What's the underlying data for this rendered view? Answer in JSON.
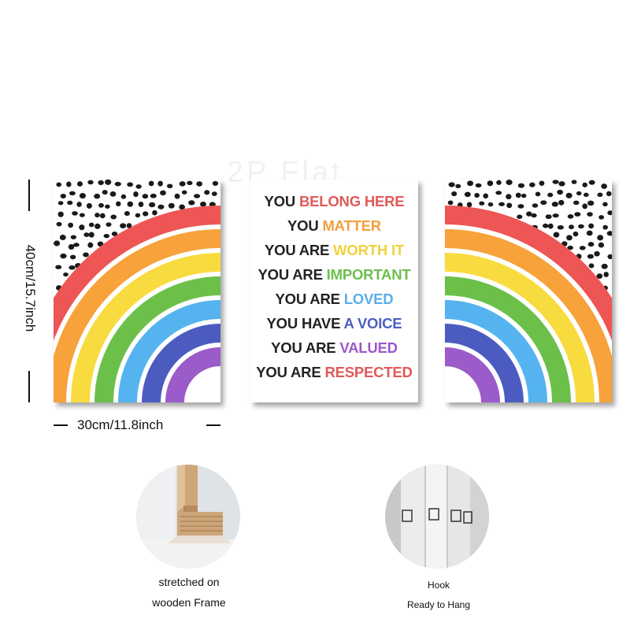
{
  "watermark": "2P Flat",
  "dimensions": {
    "height_label": "40cm/15.7inch",
    "width_label": "30cm/11.8inch"
  },
  "affirmations": [
    {
      "prefix": "YOU ",
      "highlight": "BELONG HERE",
      "color": "#e05a5a"
    },
    {
      "prefix": "YOU ",
      "highlight": "MATTER",
      "color": "#f2a03d"
    },
    {
      "prefix": "YOU ARE ",
      "highlight": "WORTH IT",
      "color": "#f0d23c"
    },
    {
      "prefix": "YOU ARE ",
      "highlight": "IMPORTANT",
      "color": "#6cbf4e"
    },
    {
      "prefix": "YOU ARE ",
      "highlight": "LOVED",
      "color": "#5aaee8"
    },
    {
      "prefix": "YOU HAVE ",
      "highlight": "A VOICE",
      "color": "#4a5fc1"
    },
    {
      "prefix": "YOU ARE ",
      "highlight": "VALUED",
      "color": "#9a58c9"
    },
    {
      "prefix": "YOU ARE ",
      "highlight": "RESPECTED",
      "color": "#e05a5a"
    }
  ],
  "rainbow_colors": [
    "#ee5555",
    "#f7a23b",
    "#f8dc3f",
    "#6cc04a",
    "#55b4ef",
    "#4b5bbf",
    "#9b5bc8"
  ],
  "captions": {
    "frame_line1": "stretched on",
    "frame_line2": "wooden Frame",
    "hook_line1": "Hook",
    "hook_line2": "Ready to Hang"
  }
}
